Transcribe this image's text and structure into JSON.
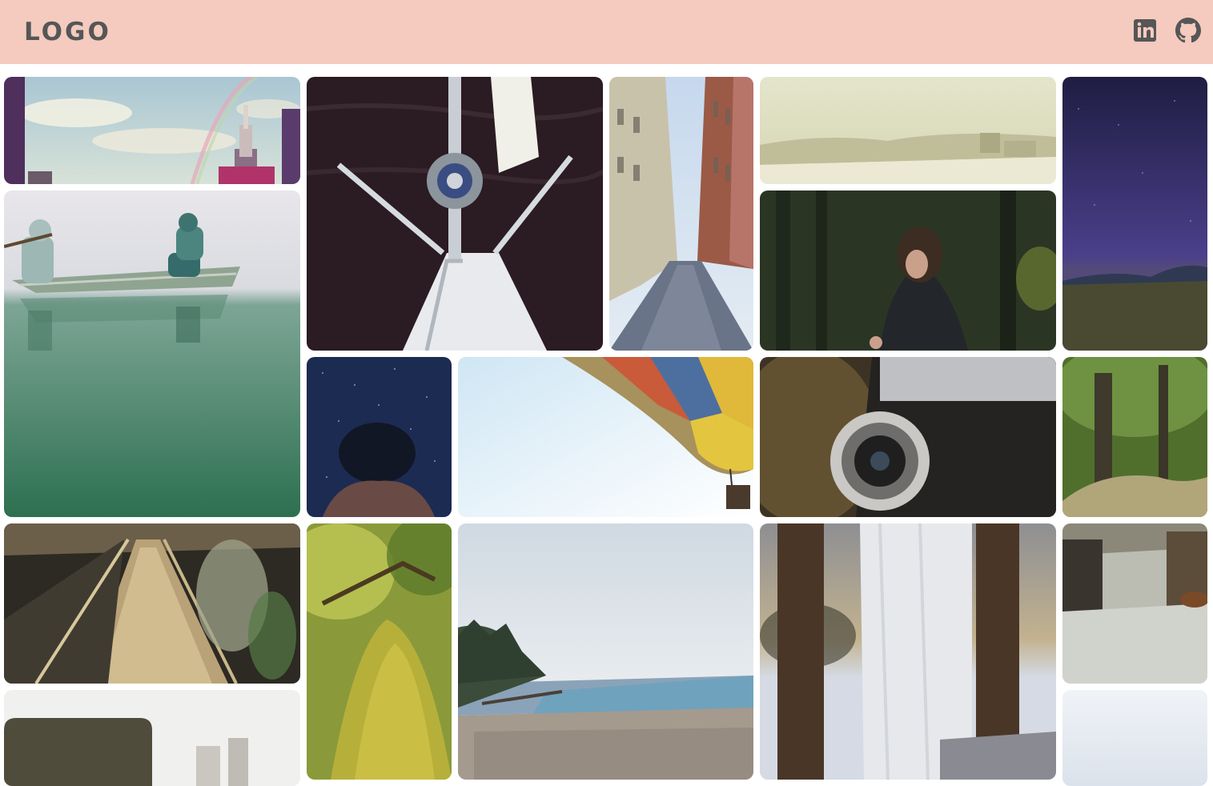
{
  "header": {
    "logo_text": "LOGO",
    "background": "#f4cbbe",
    "icons": [
      "linkedin-icon",
      "github-icon"
    ]
  },
  "gallery": {
    "photos": [
      "empire-state-rainbow",
      "canoe-lake",
      "sailboat-bow",
      "city-street",
      "foggy-beach",
      "woman-forest",
      "night-sky-field",
      "underwater-swimmer",
      "hot-air-balloon",
      "vintage-camera",
      "forest-path",
      "escalator",
      "mossy-branch",
      "pebble-beach",
      "window-curtain",
      "subway-car",
      "table-blur",
      "pale-sky"
    ]
  }
}
